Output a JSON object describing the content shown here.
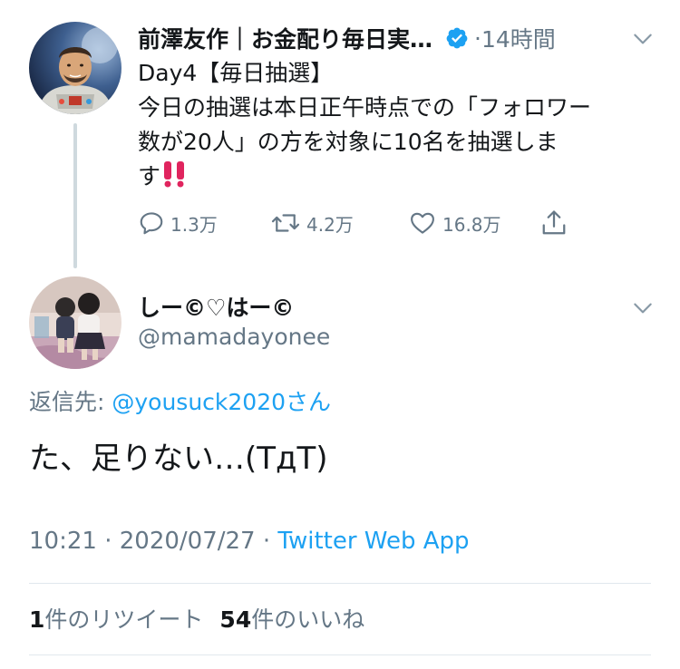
{
  "parent_tweet": {
    "author_name": "前澤友作｜お金配り毎日実…",
    "verified": true,
    "dot": "·",
    "time": "14時間",
    "text_lines": [
      "Day4【毎日抽選】",
      "今日の抽選は本日正午時点での「フォロワー",
      "数が20人」の方を対象に10名を抽選しま",
      "す"
    ],
    "emoji": "double-exclamation-icon",
    "actions": {
      "replies": "1.3万",
      "retweets": "4.2万",
      "likes": "16.8万"
    }
  },
  "reply_tweet": {
    "author_name": "しー©♡はー©",
    "handle": "@mamadayonee",
    "replying_to_label": "返信先: ",
    "replying_to_user": "@yousuck2020さん",
    "text": "た、足りない…(TдT)",
    "time": "10:21",
    "separator": " · ",
    "date": "2020/07/27",
    "source": "Twitter Web App",
    "retweets_count": "1",
    "retweets_label": "件のリツイート",
    "likes_count": "54",
    "likes_label": "件のいいね"
  },
  "colors": {
    "text": "#14171a",
    "secondary": "#657786",
    "accent": "#1da1f2",
    "divider": "#e1e8ed",
    "thread_line": "#cfd9de",
    "emoji_red": "#e0245e"
  }
}
